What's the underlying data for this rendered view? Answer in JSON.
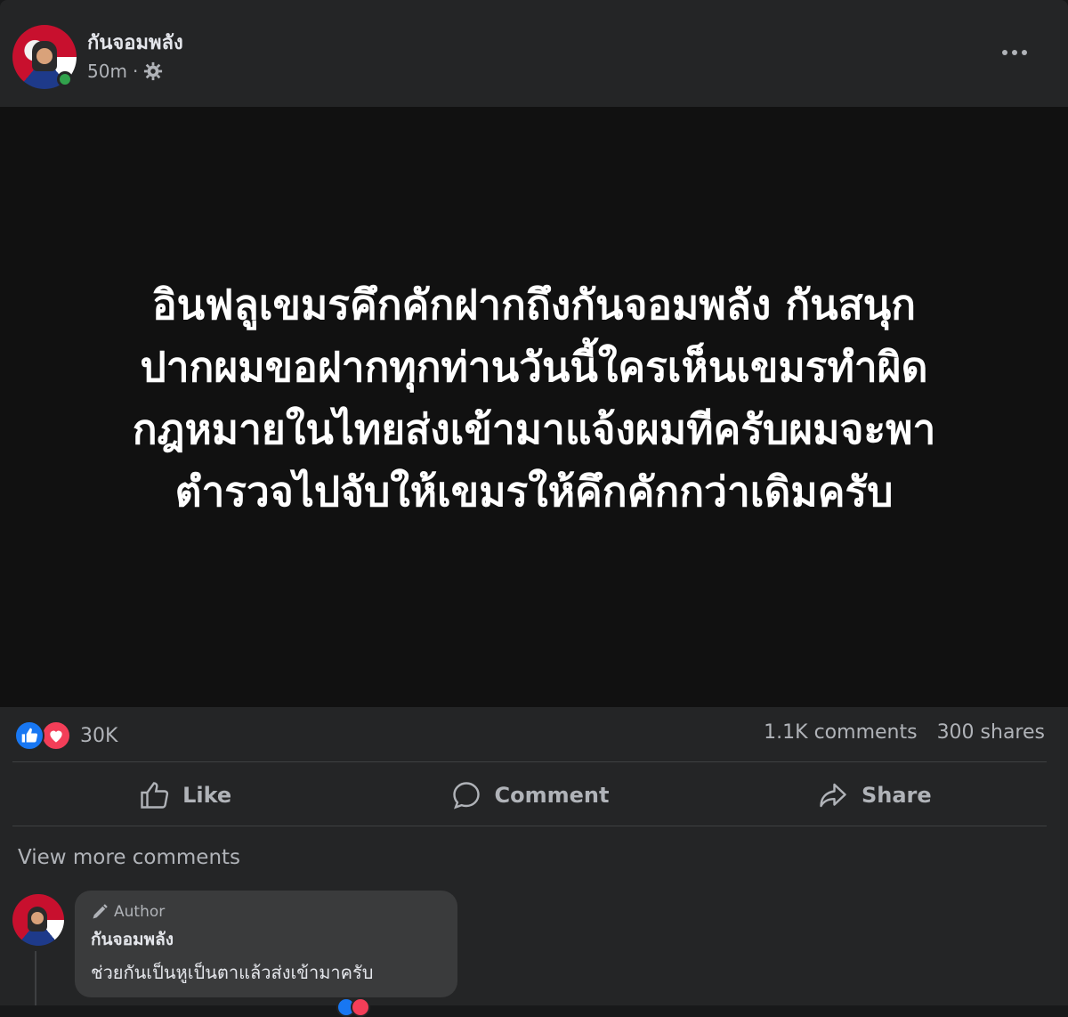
{
  "post": {
    "author": "กันจอมพลัง",
    "time": "50m",
    "separator": "·",
    "card_text": "อินฟลูเขมรคึกคักฝากถึงกันจอมพลัง กันสนุกปากผมขอฝากทุกท่านวันนี้ใครเห็นเขมรทำผิดกฎหมายในไทยส่งเข้ามาแจ้งผมทีครับผมจะพาตำรวจไปจับให้เขมรให้คึกคักกว่าเดิมครับ",
    "card_lines": [
      "อินฟลูเขมรคึกคักฝากถึงกันจอมพลัง กันสนุก",
      "ปากผมขอฝากทุกท่านวันนี้ใครเห็นเขมรทำผิด",
      "กฎหมายในไทยส่งเข้ามาแจ้งผมทีครับผมจะพา",
      "ตำรวจไปจับให้เขมรให้คึกคักกว่าเดิมครับ"
    ]
  },
  "reactions": {
    "count": "30K",
    "comments": "1.1K comments",
    "shares": "300 shares"
  },
  "actions": {
    "like": "Like",
    "comment": "Comment",
    "share": "Share"
  },
  "comments_section": {
    "view_more": "View more comments",
    "comment": {
      "badge": "Author",
      "author": "กันจอมพลัง",
      "text": "ช่วยกันเป็นหูเป็นตาแล้วส่งเข้ามาครับ"
    }
  },
  "colors": {
    "background": "#242526",
    "card": "#111111",
    "like_blue": "#1877f2",
    "love_red": "#f33e58",
    "online_green": "#31a24c"
  },
  "icons": [
    "gear-icon",
    "more-icon",
    "like-reaction-icon",
    "love-reaction-icon",
    "like-icon",
    "comment-icon",
    "share-icon",
    "pencil-icon"
  ]
}
